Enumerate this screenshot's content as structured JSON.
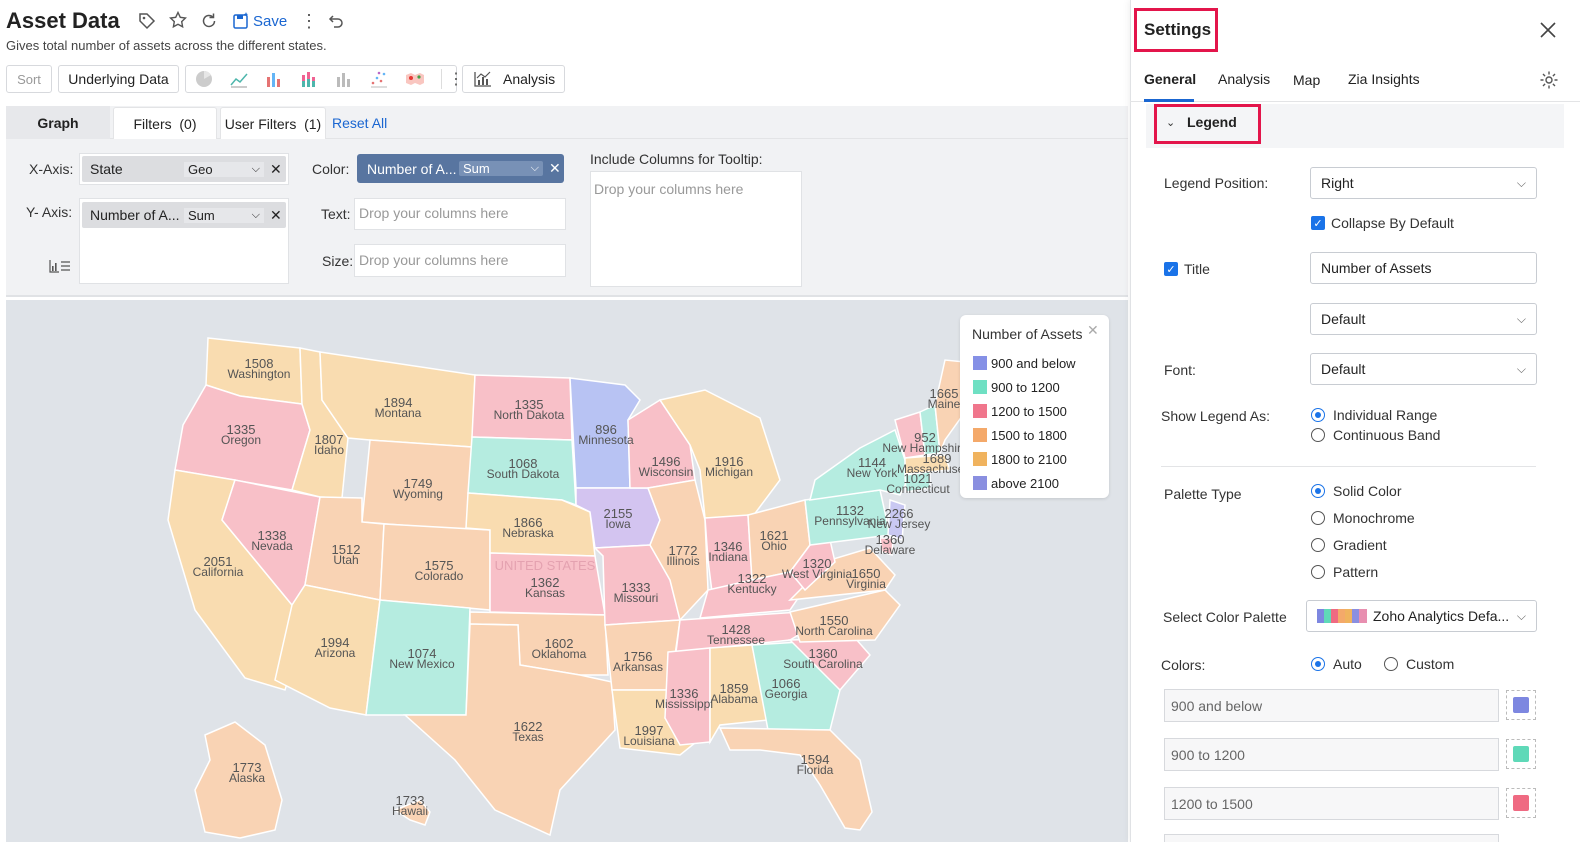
{
  "header": {
    "title": "Asset Data",
    "subtitle": "Gives total number of assets across the different states.",
    "save_label": "Save"
  },
  "toolbar": {
    "sort_label": "Sort",
    "underlying_label": "Underlying Data",
    "analysis_label": "Analysis",
    "chart_types": [
      "pie-chart-icon",
      "line-chart-icon",
      "bar-chart-icon",
      "stacked-bar-icon",
      "column-chart-icon",
      "scatter-icon",
      "map-icon"
    ]
  },
  "tabs": {
    "graph": "Graph",
    "filters": "Filters  (0)",
    "user_filters": "User Filters  (1)",
    "reset_all": "Reset All"
  },
  "shelf": {
    "x_axis_label": "X-Axis:",
    "x_field": "State",
    "x_agg": "Geo",
    "y_axis_label": "Y- Axis:",
    "y_field": "Number of A...",
    "y_agg": "Sum",
    "color_label": "Color:",
    "color_field": "Number of A...",
    "color_agg": "Sum",
    "text_label": "Text:",
    "text_placeholder": "Drop your columns here",
    "size_label": "Size:",
    "size_placeholder": "Drop your columns here",
    "tooltip_label": "Include Columns for Tooltip:",
    "tooltip_placeholder": "Drop your columns here"
  },
  "legend": {
    "title": "Number of Assets",
    "items": [
      {
        "label": "900 and below",
        "color": "#8590e6"
      },
      {
        "label": "900 to 1200",
        "color": "#6fe0c3"
      },
      {
        "label": "1200 to 1500",
        "color": "#f0768c"
      },
      {
        "label": "1500 to 1800",
        "color": "#f4a96a"
      },
      {
        "label": "1800 to 2100",
        "color": "#f0b35e"
      },
      {
        "label": "above 2100",
        "color": "#8a8fe0"
      }
    ]
  },
  "map": {
    "country_label": "UNITED STATES",
    "states": [
      {
        "name": "Washington",
        "value": "1508"
      },
      {
        "name": "Oregon",
        "value": "1335"
      },
      {
        "name": "California",
        "value": "2051"
      },
      {
        "name": "Idaho",
        "value": "1807"
      },
      {
        "name": "Nevada",
        "value": "1338"
      },
      {
        "name": "Montana",
        "value": "1894"
      },
      {
        "name": "Wyoming",
        "value": "1749"
      },
      {
        "name": "Utah",
        "value": "1512"
      },
      {
        "name": "Arizona",
        "value": "1994"
      },
      {
        "name": "Colorado",
        "value": "1575"
      },
      {
        "name": "New Mexico",
        "value": "1074"
      },
      {
        "name": "North Dakota",
        "value": "1335"
      },
      {
        "name": "South Dakota",
        "value": "1068"
      },
      {
        "name": "Nebraska",
        "value": "1866"
      },
      {
        "name": "Kansas",
        "value": "1362"
      },
      {
        "name": "Oklahoma",
        "value": "1602"
      },
      {
        "name": "Texas",
        "value": "1622"
      },
      {
        "name": "Minnesota",
        "value": "896"
      },
      {
        "name": "Iowa",
        "value": "2155"
      },
      {
        "name": "Missouri",
        "value": "1333"
      },
      {
        "name": "Arkansas",
        "value": "1756"
      },
      {
        "name": "Louisiana",
        "value": "1997"
      },
      {
        "name": "Wisconsin",
        "value": "1496"
      },
      {
        "name": "Illinois",
        "value": "1772"
      },
      {
        "name": "Michigan",
        "value": "1916"
      },
      {
        "name": "Indiana",
        "value": "1346"
      },
      {
        "name": "Ohio",
        "value": "1621"
      },
      {
        "name": "Kentucky",
        "value": "1322"
      },
      {
        "name": "Tennessee",
        "value": "1428"
      },
      {
        "name": "Mississippi",
        "value": "1336"
      },
      {
        "name": "Alabama",
        "value": "1859"
      },
      {
        "name": "Georgia",
        "value": "1066"
      },
      {
        "name": "Florida",
        "value": "1594"
      },
      {
        "name": "South Carolina",
        "value": "1360"
      },
      {
        "name": "North Carolina",
        "value": "1550"
      },
      {
        "name": "Virginia",
        "value": "1650"
      },
      {
        "name": "West Virginia",
        "value": "1320"
      },
      {
        "name": "Pennsylvania",
        "value": "1132"
      },
      {
        "name": "New York",
        "value": "1144"
      },
      {
        "name": "New Jersey",
        "value": "2266"
      },
      {
        "name": "Delaware",
        "value": "1360"
      },
      {
        "name": "Connecticut",
        "value": "1021"
      },
      {
        "name": "Massachusetts",
        "value": "1689"
      },
      {
        "name": "New Hampshire",
        "value": "952"
      },
      {
        "name": "Maine",
        "value": "1665"
      },
      {
        "name": "Alaska",
        "value": "1773"
      },
      {
        "name": "Hawaii",
        "value": "1733"
      }
    ]
  },
  "settings": {
    "title": "Settings",
    "tabs": [
      "General",
      "Analysis",
      "Map",
      "Zia Insights"
    ],
    "section": "Legend",
    "legend_position_label": "Legend Position:",
    "legend_position_value": "Right",
    "collapse_label": "Collapse By Default",
    "title_label": "Title",
    "title_value": "Number of Assets",
    "title_style_value": "Default",
    "font_label": "Font:",
    "font_value": "Default",
    "show_legend_as_label": "Show Legend As:",
    "show_options": [
      "Individual Range",
      "Continuous Band"
    ],
    "palette_type_label": "Palette Type",
    "palette_options": [
      "Solid Color",
      "Monochrome",
      "Gradient",
      "Pattern"
    ],
    "select_palette_label": "Select Color Palette",
    "palette_value": "Zoho Analytics Defa...",
    "colors_label": "Colors:",
    "colors_auto": "Auto",
    "colors_custom": "Custom",
    "color_rows": [
      {
        "label": "900 and below",
        "color": "#7d87e0"
      },
      {
        "label": "900 to 1200",
        "color": "#5fd9b8"
      },
      {
        "label": "1200 to 1500",
        "color": "#ef6a82"
      }
    ]
  }
}
